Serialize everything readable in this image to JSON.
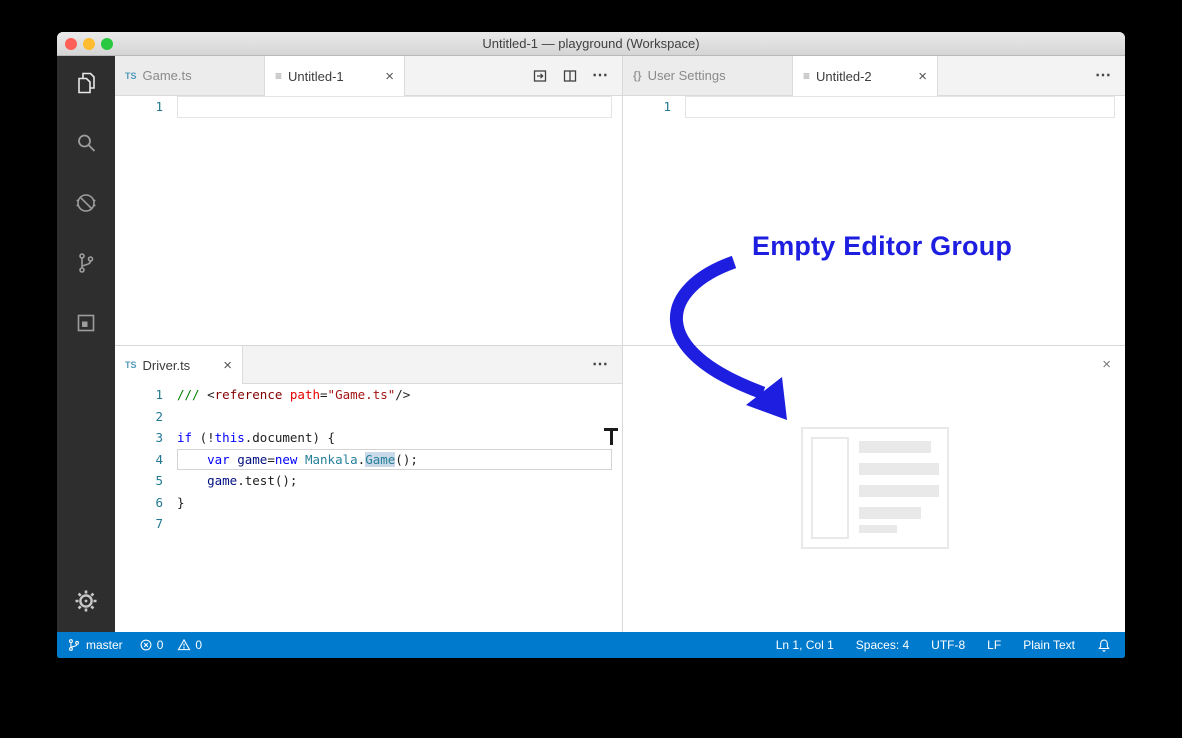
{
  "window": {
    "title": "Untitled-1 — playground (Workspace)"
  },
  "icons": {
    "ts_badge": "TS",
    "file_badge": "≡",
    "braces_badge": "{}",
    "close": "×",
    "more_actions": "⋯"
  },
  "activity_bar": {
    "items": [
      "explorer",
      "search",
      "debug",
      "source-control",
      "extensions"
    ],
    "bottom": "settings-gear"
  },
  "editor_groups": {
    "top_left": {
      "tabs": [
        {
          "icon": "typescript",
          "label": "Game.ts",
          "active": false
        },
        {
          "icon": "file",
          "label": "Untitled-1",
          "active": true
        }
      ],
      "line_number": "1"
    },
    "top_right": {
      "tabs": [
        {
          "icon": "braces",
          "label": "User Settings",
          "active": false
        },
        {
          "icon": "file",
          "label": "Untitled-2",
          "active": true
        }
      ],
      "line_number": "1"
    },
    "bottom_left": {
      "tabs": [
        {
          "icon": "typescript",
          "label": "Driver.ts",
          "active": true
        }
      ],
      "code_lines": [
        {
          "num": "1",
          "tokens": [
            {
              "t": "/// ",
              "c": "comment"
            },
            {
              "t": "<",
              "c": "plain"
            },
            {
              "t": "reference",
              "c": "tag"
            },
            {
              "t": " ",
              "c": "plain"
            },
            {
              "t": "path",
              "c": "attr"
            },
            {
              "t": "=",
              "c": "plain"
            },
            {
              "t": "\"Game.ts\"",
              "c": "string"
            },
            {
              "t": "/>",
              "c": "plain"
            }
          ]
        },
        {
          "num": "2",
          "tokens": []
        },
        {
          "num": "3",
          "tokens": [
            {
              "t": "if",
              "c": "kw"
            },
            {
              "t": " (!",
              "c": "plain"
            },
            {
              "t": "this",
              "c": "kw"
            },
            {
              "t": ".document) {",
              "c": "plain"
            }
          ]
        },
        {
          "num": "4",
          "current": true,
          "tokens": [
            {
              "t": "    ",
              "c": "plain"
            },
            {
              "t": "var",
              "c": "kw"
            },
            {
              "t": " ",
              "c": "plain"
            },
            {
              "t": "game",
              "c": "var"
            },
            {
              "t": "=",
              "c": "plain"
            },
            {
              "t": "new",
              "c": "kw"
            },
            {
              "t": " ",
              "c": "plain"
            },
            {
              "t": "Mankala",
              "c": "type"
            },
            {
              "t": ".",
              "c": "plain"
            },
            {
              "t": "Game",
              "c": "type",
              "hl": true
            },
            {
              "t": "();",
              "c": "plain"
            }
          ]
        },
        {
          "num": "5",
          "tokens": [
            {
              "t": "    ",
              "c": "plain"
            },
            {
              "t": "game",
              "c": "var"
            },
            {
              "t": ".test();",
              "c": "plain"
            }
          ]
        },
        {
          "num": "6",
          "tokens": [
            {
              "t": "}",
              "c": "plain"
            }
          ]
        },
        {
          "num": "7",
          "tokens": []
        }
      ]
    },
    "bottom_right": {
      "empty": true
    }
  },
  "annotation": {
    "text": "Empty Editor Group",
    "color": "#1d1ee0"
  },
  "status_bar": {
    "background": "#007acc",
    "branch": "master",
    "errors": "0",
    "warnings": "0",
    "line_col": "Ln 1, Col 1",
    "indentation": "Spaces: 4",
    "encoding": "UTF-8",
    "eol": "LF",
    "language": "Plain Text"
  }
}
